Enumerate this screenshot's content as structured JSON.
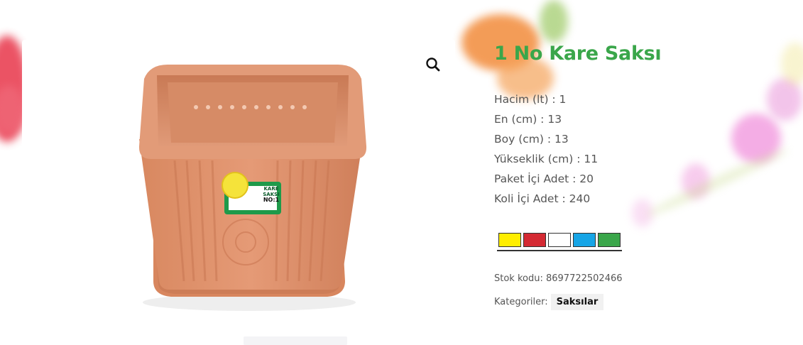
{
  "product": {
    "title": "1 No Kare Saksı",
    "specs": [
      "Hacim (lt) : 1",
      "En (cm) : 13",
      "Boy (cm) : 13",
      "Yükseklik (cm) : 11",
      "Paket İçi Adet : 20",
      "Koli İçi Adet : 240"
    ],
    "swatch_colors": [
      "#ffee00",
      "#d42a33",
      "#ffffff",
      "#17a5e6",
      "#3aa64a"
    ],
    "sku_line": "Stok kodu: 8697722502466",
    "categories_label": "Kategoriler:",
    "category": "Saksılar",
    "label": {
      "line1": "KARE",
      "line2": "SAKSI",
      "number": "NO:1"
    }
  },
  "icons": {
    "zoom": "magnifier-icon"
  },
  "colors": {
    "title_green": "#3aa64a",
    "pot_terracotta": "#d98a66"
  }
}
